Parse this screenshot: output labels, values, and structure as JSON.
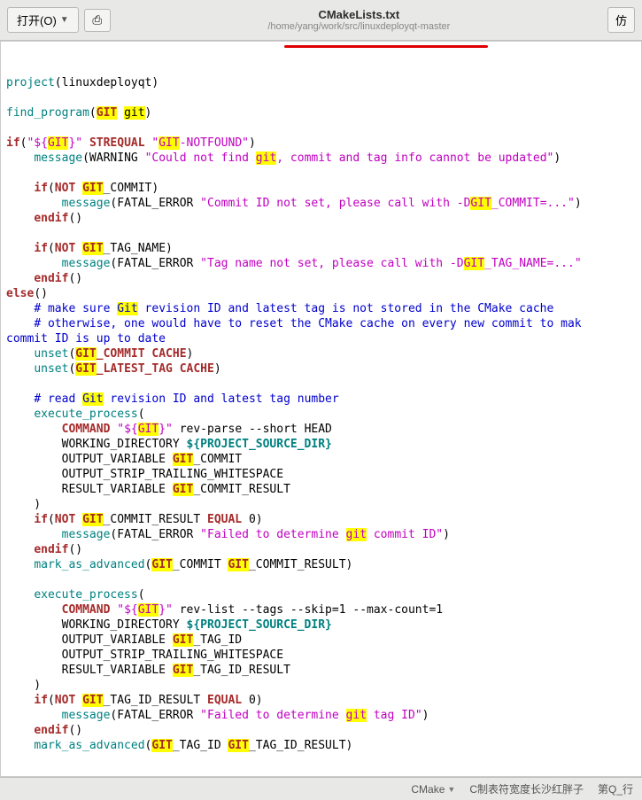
{
  "toolbar": {
    "open_label": "打开(O)",
    "right_label": "仿"
  },
  "header": {
    "title": "CMakeLists.txt",
    "subtitle": "/home/yang/work/src/linuxdeployqt-master"
  },
  "code": {
    "l01a": "project",
    "l01b": "(linuxdeployqt)",
    "l03a": "find_program",
    "l03b": "(",
    "l03c": "GIT",
    "l03d": " ",
    "l03e": "git",
    "l03f": ")",
    "l05a": "if",
    "l05b": "(",
    "l05c": "\"${",
    "l05d": "GIT",
    "l05e": "}\"",
    "l05f": " ",
    "l05g": "STREQUAL",
    "l05h": " ",
    "l05i": "\"",
    "l05j": "GIT",
    "l05k": "-NOTFOUND\"",
    "l05l": ")",
    "l06a": "    ",
    "l06b": "message",
    "l06c": "(WARNING ",
    "l06d": "\"Could not find ",
    "l06e": "git",
    "l06f": ", commit and tag info cannot be updated\"",
    "l06g": ")",
    "l08a": "    ",
    "l08b": "if",
    "l08c": "(",
    "l08d": "NOT",
    "l08e": " ",
    "l08f": "GIT",
    "l08g": "_COMMIT)",
    "l09a": "        ",
    "l09b": "message",
    "l09c": "(FATAL_ERROR ",
    "l09d": "\"Commit ID not set, please call with -D",
    "l09e": "GIT",
    "l09f": "_COMMIT=...\"",
    "l09g": ")",
    "l10a": "    ",
    "l10b": "endif",
    "l10c": "()",
    "l12a": "    ",
    "l12b": "if",
    "l12c": "(",
    "l12d": "NOT",
    "l12e": " ",
    "l12f": "GIT",
    "l12g": "_TAG_NAME)",
    "l13a": "        ",
    "l13b": "message",
    "l13c": "(FATAL_ERROR ",
    "l13d": "\"Tag name not set, please call with -D",
    "l13e": "GIT",
    "l13f": "_TAG_NAME=...\"",
    "l14a": "    ",
    "l14b": "endif",
    "l14c": "()",
    "l15a": "else",
    "l15b": "()",
    "l16a": "    ",
    "l16b": "# make sure ",
    "l16c": "Git",
    "l16d": " revision ID and latest tag is not stored in the CMake cache",
    "l17a": "    ",
    "l17b": "# otherwise, one would have to reset the CMake cache on every new commit to mak",
    "l18a": "commit ID is up to date",
    "l19a": "    ",
    "l19b": "unset",
    "l19c": "(",
    "l19d": "GIT",
    "l19e": "_COMMIT ",
    "l19f": "CACHE",
    "l19g": ")",
    "l20a": "    ",
    "l20b": "unset",
    "l20c": "(",
    "l20d": "GIT",
    "l20e": "_LATEST_TAG ",
    "l20f": "CACHE",
    "l20g": ")",
    "l22a": "    ",
    "l22b": "# read ",
    "l22c": "Git",
    "l22d": " revision ID and latest tag number",
    "l23a": "    ",
    "l23b": "execute_process",
    "l23c": "(",
    "l24a": "        ",
    "l24b": "COMMAND",
    "l24c": " ",
    "l24d": "\"${",
    "l24e": "GIT",
    "l24f": "}\"",
    "l24g": " rev-parse --short HEAD",
    "l25a": "        WORKING_DIRECTORY ",
    "l25b": "${",
    "l25c": "PROJECT_SOURCE_DIR",
    "l25d": "}",
    "l26a": "        OUTPUT_VARIABLE ",
    "l26b": "GIT",
    "l26c": "_COMMIT",
    "l27a": "        OUTPUT_STRIP_TRAILING_WHITESPACE",
    "l28a": "        RESULT_VARIABLE ",
    "l28b": "GIT",
    "l28c": "_COMMIT_RESULT",
    "l29a": "    )",
    "l30a": "    ",
    "l30b": "if",
    "l30c": "(",
    "l30d": "NOT",
    "l30e": " ",
    "l30f": "GIT",
    "l30g": "_COMMIT_RESULT ",
    "l30h": "EQUAL",
    "l30i": " 0)",
    "l31a": "        ",
    "l31b": "message",
    "l31c": "(FATAL_ERROR ",
    "l31d": "\"Failed to determine ",
    "l31e": "git",
    "l31f": " commit ID\"",
    "l31g": ")",
    "l32a": "    ",
    "l32b": "endif",
    "l32c": "()",
    "l33a": "    ",
    "l33b": "mark_as_advanced",
    "l33c": "(",
    "l33d": "GIT",
    "l33e": "_COMMIT ",
    "l33f": "GIT",
    "l33g": "_COMMIT_RESULT)",
    "l35a": "    ",
    "l35b": "execute_process",
    "l35c": "(",
    "l36a": "        ",
    "l36b": "COMMAND",
    "l36c": " ",
    "l36d": "\"${",
    "l36e": "GIT",
    "l36f": "}\"",
    "l36g": " rev-list --tags --skip=1 --max-count=1",
    "l37a": "        WORKING_DIRECTORY ",
    "l37b": "${",
    "l37c": "PROJECT_SOURCE_DIR",
    "l37d": "}",
    "l38a": "        OUTPUT_VARIABLE ",
    "l38b": "GIT",
    "l38c": "_TAG_ID",
    "l39a": "        OUTPUT_STRIP_TRAILING_WHITESPACE",
    "l40a": "        RESULT_VARIABLE ",
    "l40b": "GIT",
    "l40c": "_TAG_ID_RESULT",
    "l41a": "    )",
    "l42a": "    ",
    "l42b": "if",
    "l42c": "(",
    "l42d": "NOT",
    "l42e": " ",
    "l42f": "GIT",
    "l42g": "_TAG_ID_RESULT ",
    "l42h": "EQUAL",
    "l42i": " 0)",
    "l43a": "        ",
    "l43b": "message",
    "l43c": "(FATAL_ERROR ",
    "l43d": "\"Failed to determine ",
    "l43e": "git",
    "l43f": " tag ID\"",
    "l43g": ")",
    "l44a": "    ",
    "l44b": "endif",
    "l44c": "()",
    "l45a": "    ",
    "l45b": "mark_as_advanced",
    "l45c": "(",
    "l45d": "GIT",
    "l45e": "_TAG_ID ",
    "l45f": "GIT",
    "l45g": "_TAG_ID_RESULT)"
  },
  "statusbar": {
    "lang": "CMake",
    "width": "C制表符宽度长沙红胖子",
    "line": "第Q_行"
  }
}
